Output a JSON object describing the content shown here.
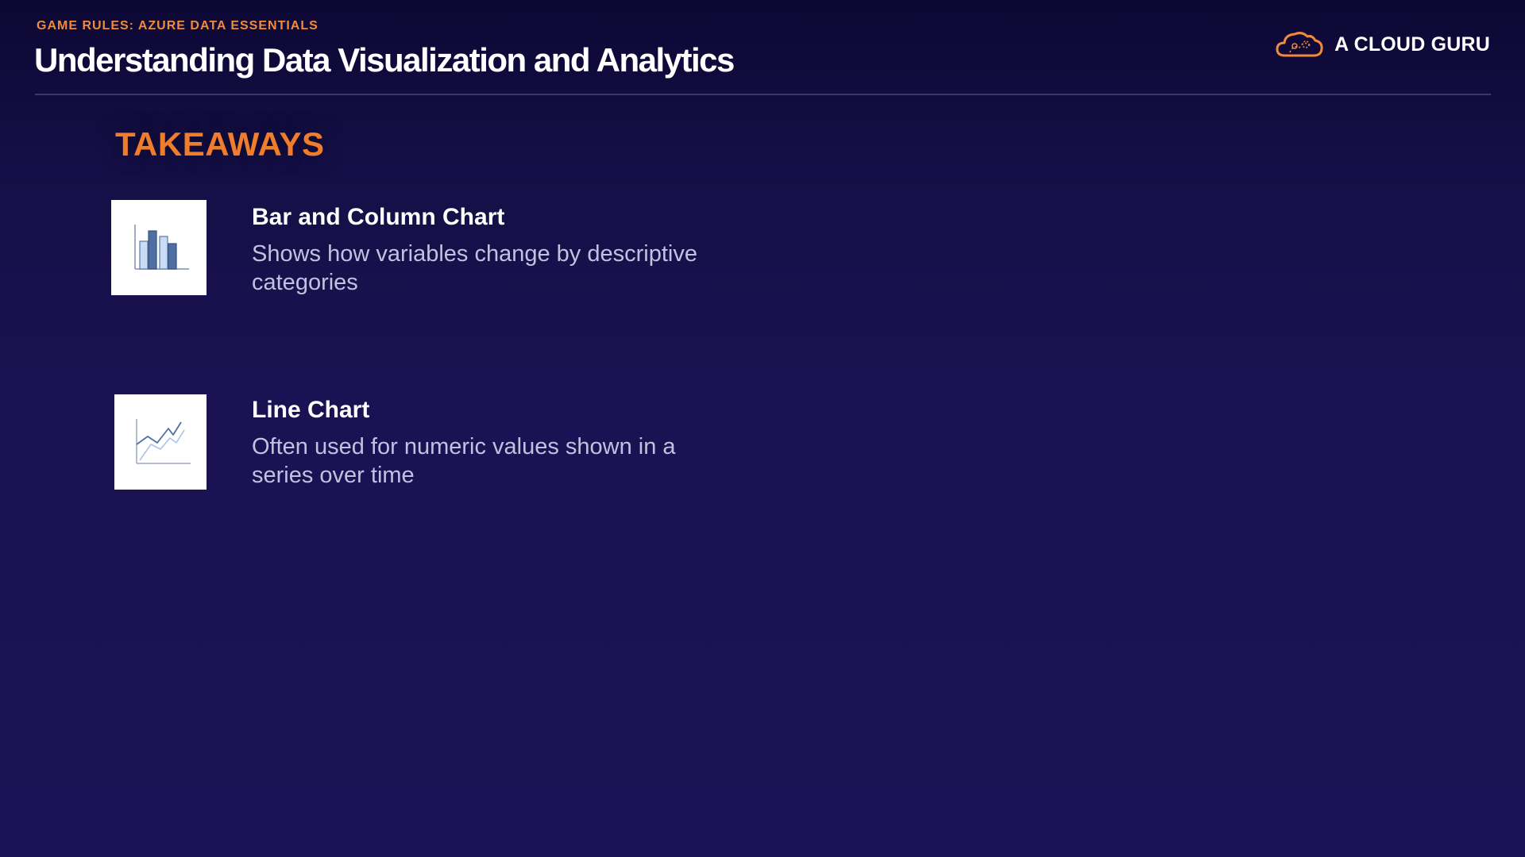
{
  "header": {
    "eyebrow": "GAME RULES: AZURE DATA ESSENTIALS",
    "title": "Understanding Data Visualization and Analytics",
    "logo_text": "A CLOUD GURU",
    "logo_icon": "cloud-logo-icon"
  },
  "main": {
    "section_heading": "TAKEAWAYS",
    "takeaways": [
      {
        "icon": "bar-chart-icon",
        "title": "Bar and Column Chart",
        "description": "Shows how variables change by descriptive categories"
      },
      {
        "icon": "line-chart-icon",
        "title": "Line Chart",
        "description": "Often used for numeric values shown in a series over time"
      }
    ]
  },
  "colors": {
    "background": "#1a1252",
    "accent": "#f07d2c",
    "eyebrow": "#f08a3c",
    "text": "#ffffff",
    "muted_text": "#c4c0e0"
  }
}
